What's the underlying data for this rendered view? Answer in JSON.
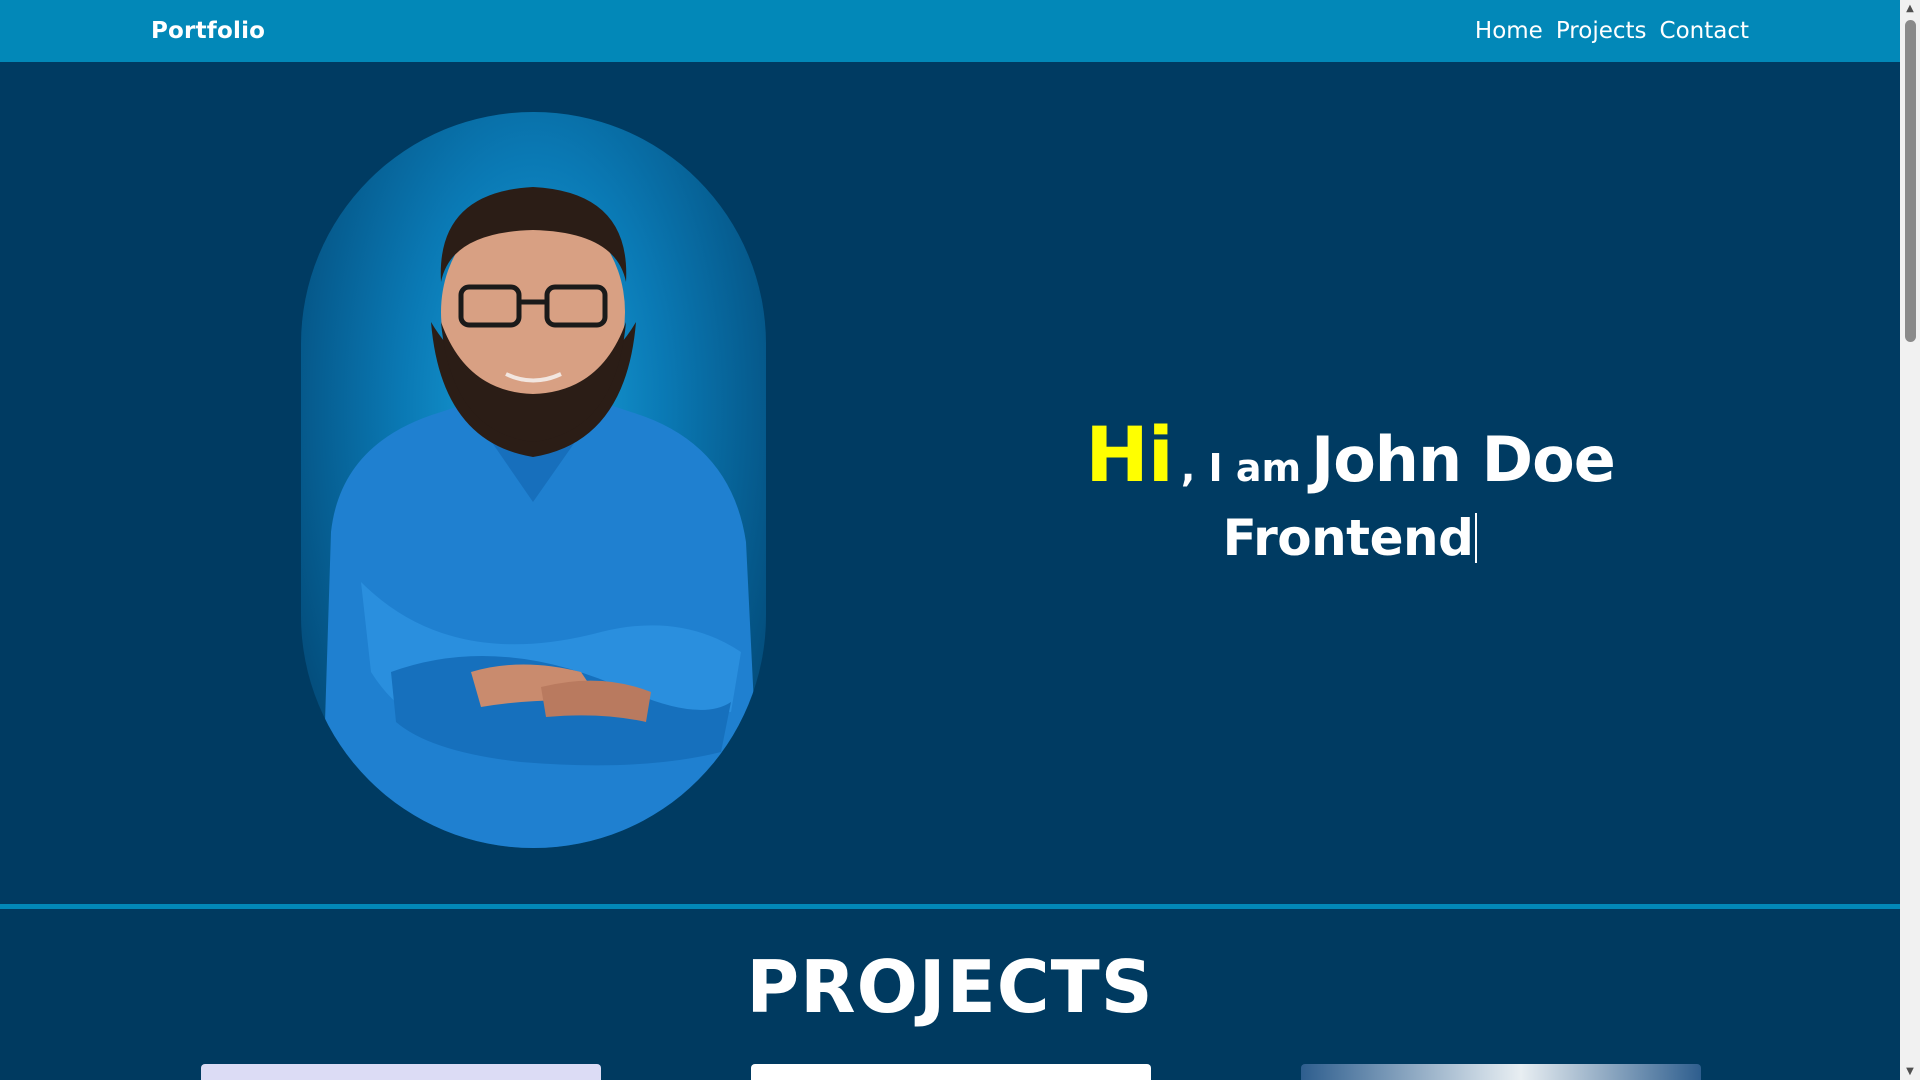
{
  "navbar": {
    "brand": "Portfolio",
    "links": [
      {
        "label": "Home"
      },
      {
        "label": "Projects"
      },
      {
        "label": "Contact"
      }
    ]
  },
  "hero": {
    "hi": "Hi",
    "iam": ", I am",
    "name": "John Doe",
    "role": "Frontend",
    "portrait_alt": "Portrait of a smiling bearded man with glasses in a blue denim shirt, arms crossed",
    "colors": {
      "hi": "#ffff00",
      "background": "#003b62"
    }
  },
  "projects": {
    "title": "PROJECTS",
    "cards": [
      {
        "name": "project-card-1"
      },
      {
        "name": "project-card-2"
      },
      {
        "name": "project-card-3"
      }
    ]
  },
  "colors": {
    "navbar": "#0288b8",
    "page_background": "#003b62",
    "accent": "#0288b8"
  }
}
